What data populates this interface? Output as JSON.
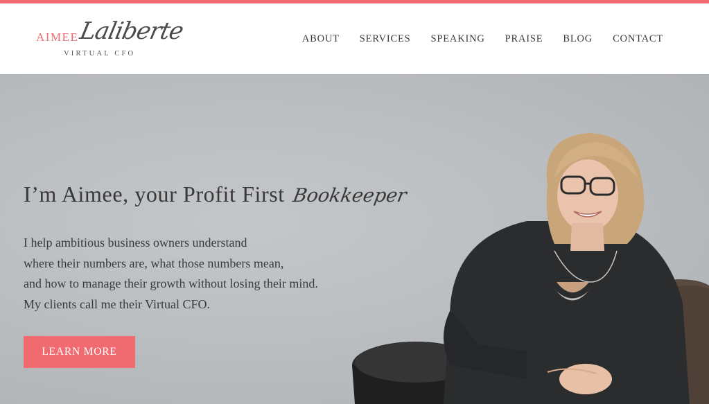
{
  "brand": {
    "first_name": "AIMEE",
    "last_name": "Laliberte",
    "tagline": "VIRTUAL CFO",
    "accent_color": "#ef6b70"
  },
  "nav": {
    "items": [
      "ABOUT",
      "SERVICES",
      "SPEAKING",
      "PRAISE",
      "BLOG",
      "CONTACT"
    ]
  },
  "hero": {
    "heading": "I’m Aimee, your Profit First",
    "heading_script": "Bookkeeper",
    "body_lines": [
      "I help ambitious business owners understand",
      "where their numbers are, what those numbers mean,",
      "and how to manage their growth without losing their mind.",
      "My clients call me their Virtual CFO."
    ],
    "cta_label": "LEARN MORE"
  }
}
